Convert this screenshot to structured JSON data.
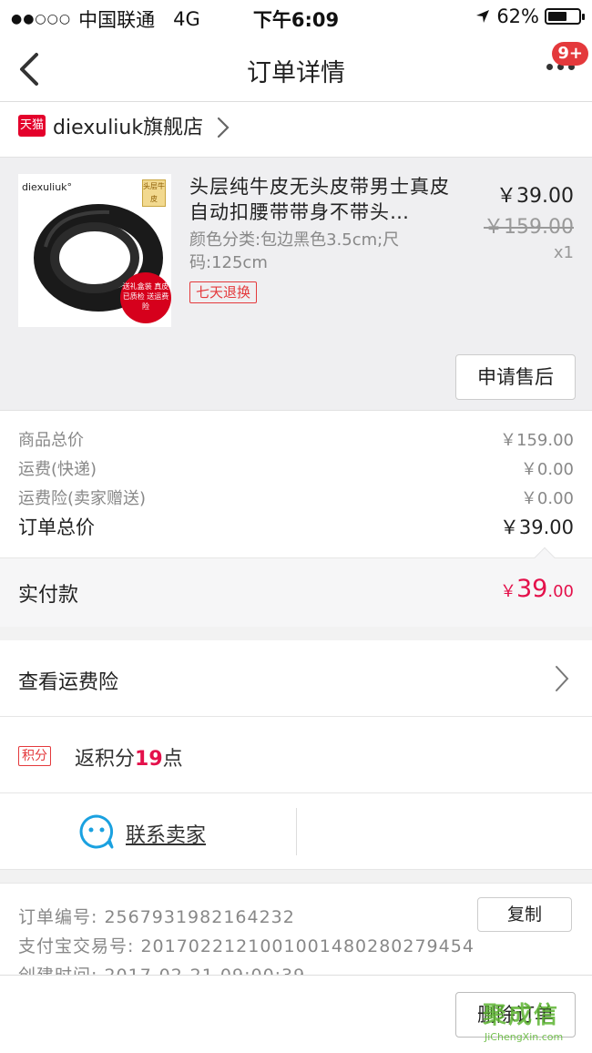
{
  "status_bar": {
    "signal_dots": "●●○○○",
    "carrier": "中国联通",
    "network": "4G",
    "time": "下午6:09",
    "battery_percent": "62%",
    "battery_level": 0.62
  },
  "nav": {
    "title": "订单详情",
    "badge": "9+"
  },
  "shop": {
    "platform_label": "天猫",
    "name": "diexuliuk旗舰店"
  },
  "product": {
    "thumb_brand": "diexuliuk°",
    "thumb_tag": "头层牛皮",
    "thumb_seal": "送礼盒装 真皮已质检 送运费险",
    "name": "头层纯牛皮无头皮带男士真皮自动扣腰带带身不带头…",
    "sku": "颜色分类:包边黑色3.5cm;尺码:125cm",
    "return_tag": "七天退换",
    "price": "￥39.00",
    "original_price": "￥159.00",
    "quantity": "x1",
    "after_sale_button": "申请售后"
  },
  "summary": {
    "rows": [
      {
        "label": "商品总价",
        "value": "￥159.00"
      },
      {
        "label": "运费(快递)",
        "value": "￥0.00"
      },
      {
        "label": "运费险(卖家赠送)",
        "value": "￥0.00"
      }
    ],
    "total_label": "订单总价",
    "total_value": "￥39.00",
    "paid_label": "实付款",
    "paid_currency": "￥",
    "paid_int": "39",
    "paid_dec": ".00"
  },
  "insurance": {
    "label": "查看运费险"
  },
  "points": {
    "tag": "积分",
    "prefix": "返积分",
    "number": "19",
    "suffix": "点"
  },
  "contact": {
    "label": "联系卖家"
  },
  "order_info": {
    "order_no": "订单编号:  2567931982164232",
    "alipay_no": "支付宝交易号:  2017022121001001480280279454",
    "created": "创建时间:  2017-02-21 09:00:39",
    "copy_button": "复制"
  },
  "bottom": {
    "delete_button": "删除订单",
    "watermark_logo": "聚成信",
    "watermark_url": "JiChengXin.com"
  }
}
